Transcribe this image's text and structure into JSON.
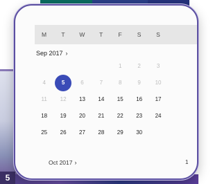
{
  "background": {
    "badge_text": "5",
    "colors": {
      "teal_tile": "#0b6b5f",
      "blue_tile": "#2a3e86",
      "purple_band": "#6a4fa6"
    }
  },
  "calendar": {
    "weekdays": [
      "M",
      "T",
      "W",
      "T",
      "F",
      "S",
      "S"
    ],
    "current_month_label": "Sep 2017",
    "next_month_label": "Oct 2017",
    "trailing_day": "1",
    "selected_day": "5",
    "accent_color": "#3a4bb7",
    "rows": [
      [
        "",
        "",
        "",
        "",
        "1",
        "2",
        "3"
      ],
      [
        "4",
        "5",
        "6",
        "7",
        "8",
        "9",
        "10"
      ],
      [
        "11",
        "12",
        "13",
        "14",
        "15",
        "16",
        "17"
      ],
      [
        "18",
        "19",
        "20",
        "21",
        "22",
        "23",
        "24"
      ],
      [
        "25",
        "26",
        "27",
        "28",
        "29",
        "30",
        ""
      ]
    ]
  }
}
